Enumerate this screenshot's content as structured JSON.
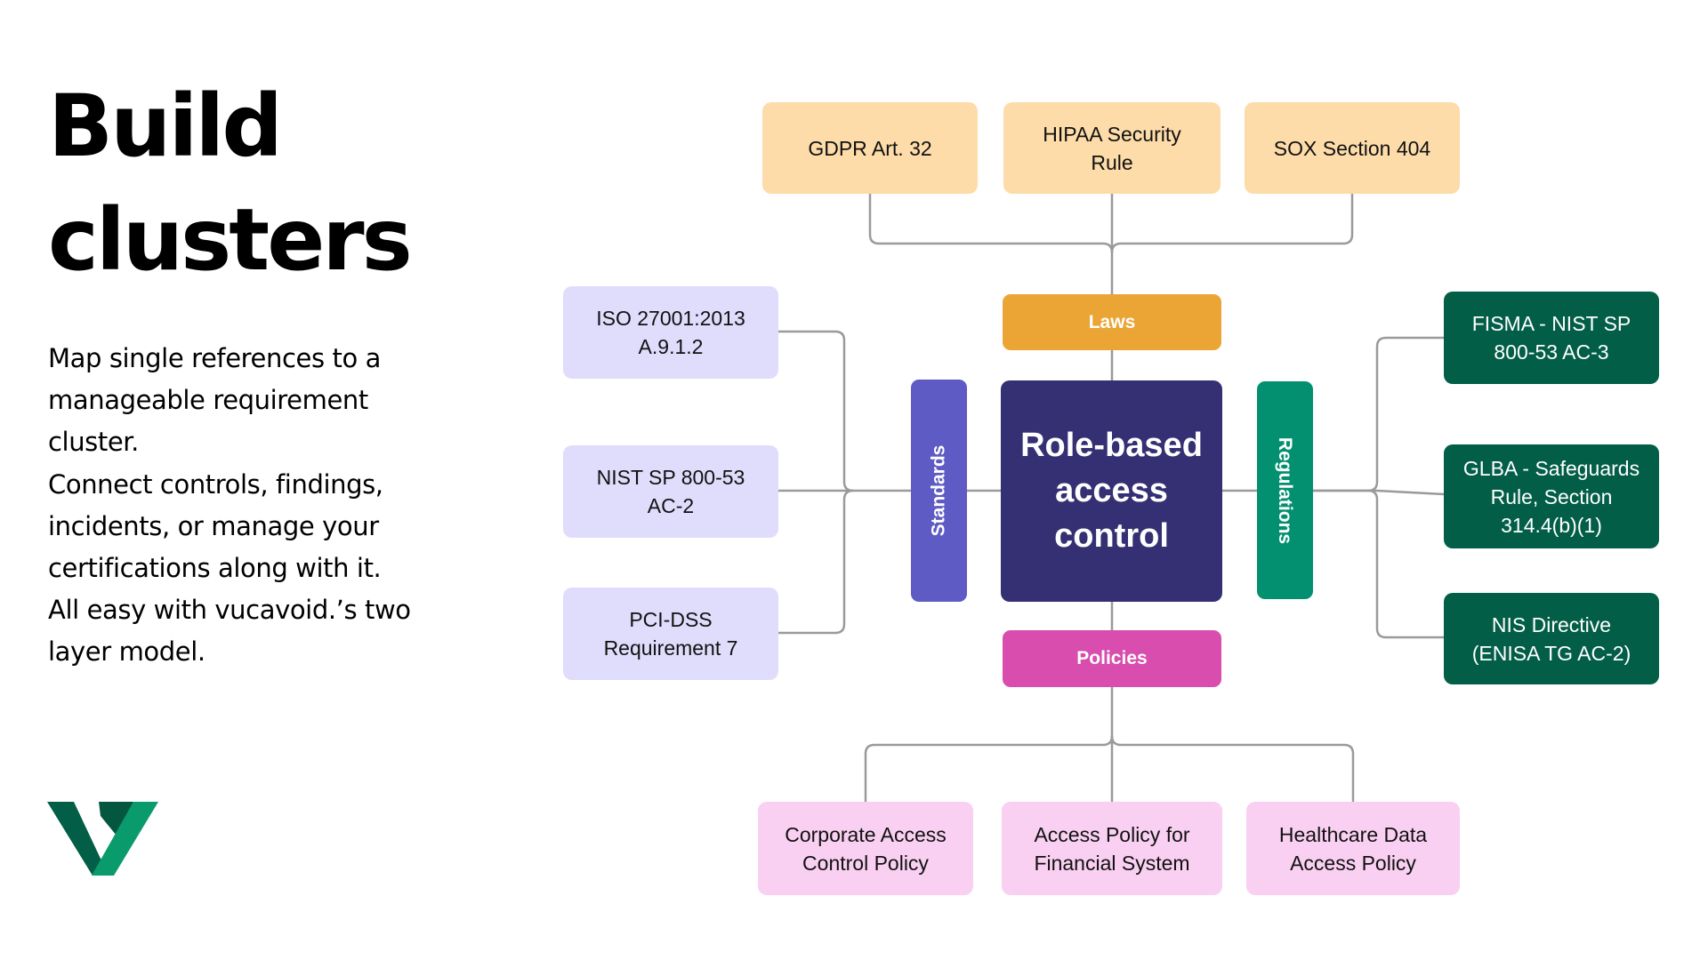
{
  "heading": {
    "lines": [
      "Build",
      "clusters"
    ]
  },
  "description": {
    "lines": [
      "Map single references to a",
      "manageable requirement",
      "cluster.",
      "Connect controls, findings,",
      "incidents, or manage your",
      "certifications along with it.",
      "All easy with vucavoid.’s two",
      "layer model."
    ]
  },
  "logo": {
    "icon": "vucavoid-v-logo",
    "colors": {
      "dark": "#035e48",
      "mid": "#04573f",
      "bright": "#0a9b6d"
    }
  },
  "diagram": {
    "core": {
      "label": "Role-based access control",
      "color": "#353073"
    },
    "categories": {
      "laws": {
        "label": "Laws",
        "color": "#eba535"
      },
      "standards": {
        "label": "Standards",
        "color": "#5f5bc4"
      },
      "regulations": {
        "label": "Regulations",
        "color": "#039070"
      },
      "policies": {
        "label": "Policies",
        "color": "#d84dad"
      }
    },
    "laws": [
      {
        "label": "GDPR Art. 32"
      },
      {
        "label": "HIPAA Security Rule"
      },
      {
        "label": "SOX Section 404"
      }
    ],
    "standards": [
      {
        "label": "ISO 27001:2013 A.9.1.2"
      },
      {
        "label": "NIST SP 800-53 AC-2"
      },
      {
        "label": "PCI-DSS Requirement 7"
      }
    ],
    "regulations": [
      {
        "label": "FISMA - NIST SP 800-53 AC-3"
      },
      {
        "label": "GLBA -  Safeguards Rule, Section 314.4(b)(1)"
      },
      {
        "label": "NIS Directive (ENISA TG AC-2)"
      }
    ],
    "policies": [
      {
        "label": "Corporate Access Control Policy"
      },
      {
        "label": "Access Policy for Financial System"
      },
      {
        "label": "Healthcare Data Access Policy"
      }
    ],
    "item_colors": {
      "laws": "#fddcaa",
      "standards": "#e0dcfc",
      "regulations": "#035e48",
      "policies": "#f9d0f1",
      "connector": "#9a9a9a"
    }
  }
}
